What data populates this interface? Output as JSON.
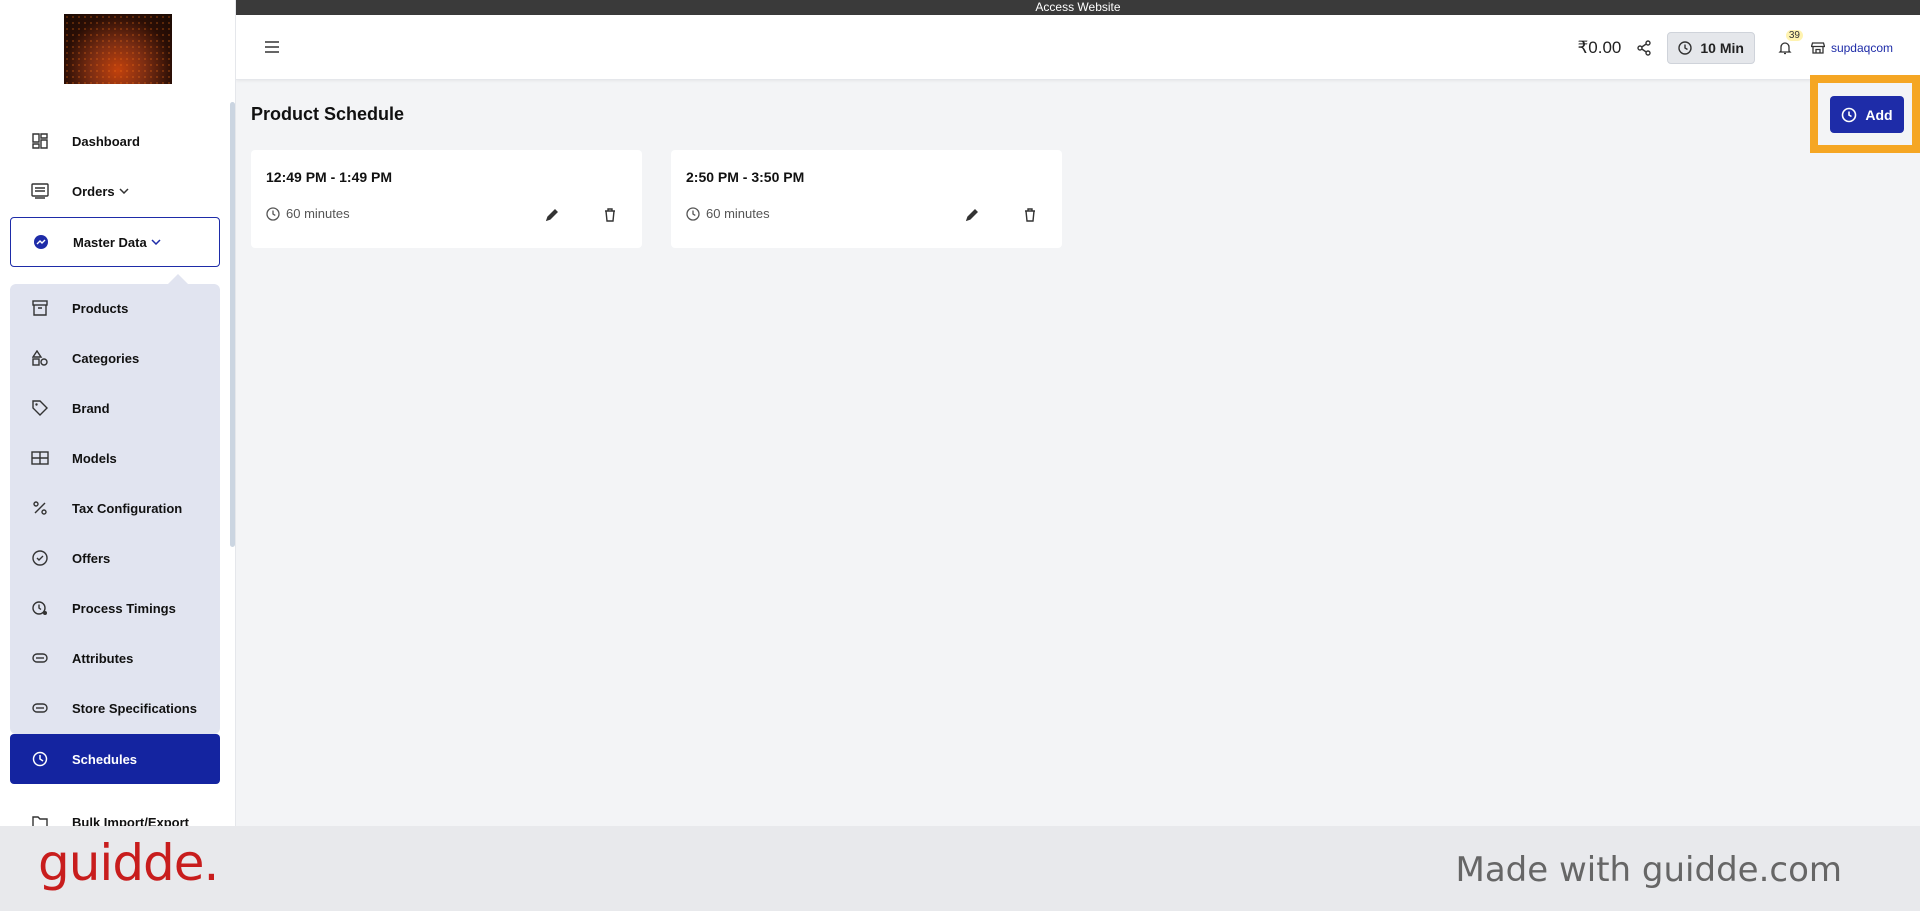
{
  "access_bar": {
    "label": "Access Website"
  },
  "header": {
    "balance": "₹0.00",
    "time_chip": "10 Min",
    "notification_count": "39",
    "store_name": "supdaqcom"
  },
  "sidebar": {
    "items": {
      "dashboard": "Dashboard",
      "orders": "Orders",
      "master_data": "Master Data",
      "products": "Products",
      "categories": "Categories",
      "brand": "Brand",
      "models": "Models",
      "tax": "Tax Configuration",
      "offers": "Offers",
      "process_timings": "Process Timings",
      "attributes": "Attributes",
      "store_specifications": "Store Specifications",
      "schedules": "Schedules",
      "bulk": "Bulk Import/Export"
    },
    "active_item": "Schedules"
  },
  "main": {
    "title": "Product Schedule",
    "add_label": "Add",
    "schedules": [
      {
        "time": "12:49 PM - 1:49 PM",
        "duration": "60 minutes"
      },
      {
        "time": "2:50 PM - 3:50 PM",
        "duration": "60 minutes"
      }
    ]
  },
  "footer": {
    "brand": "guidde.",
    "made_with": "Made with guidde.com"
  },
  "colors": {
    "accent": "#1e2ca8",
    "active_nav": "#1424a0",
    "highlight": "#f5a623",
    "brand_red": "#c81d1d"
  }
}
